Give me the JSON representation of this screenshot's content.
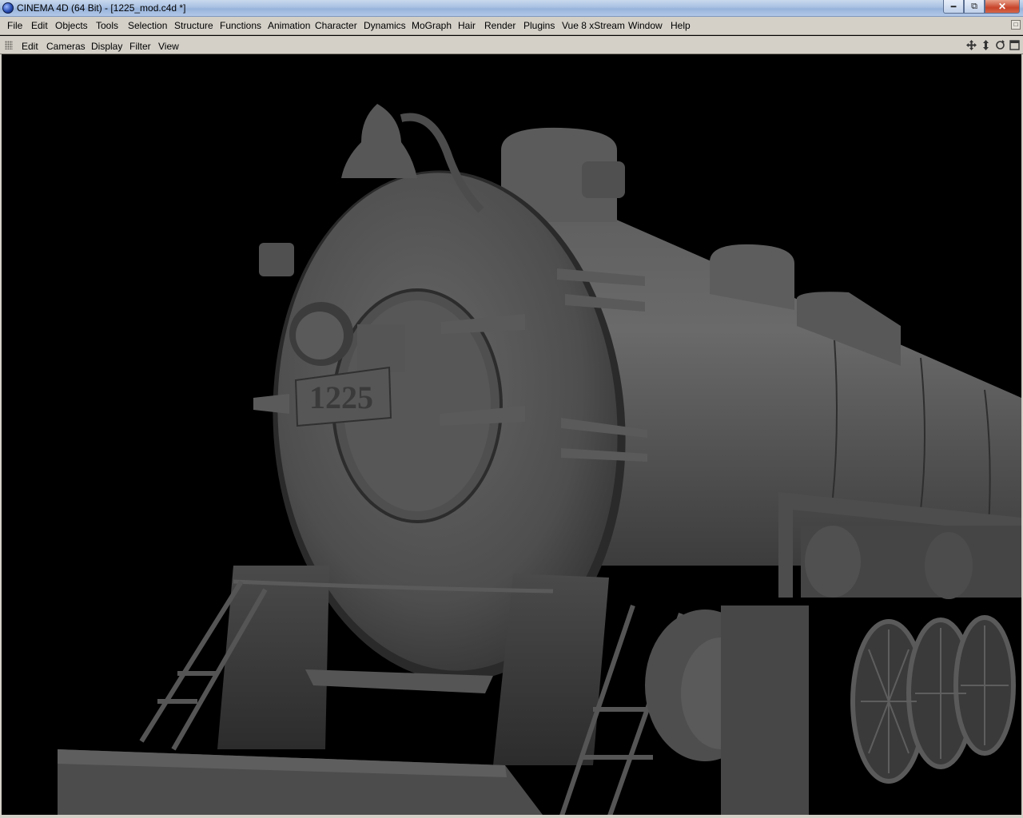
{
  "window": {
    "title": "CINEMA 4D (64 Bit) - [1225_mod.c4d *]",
    "app_icon": "cinema4d-icon",
    "controls": {
      "minimize": "minimize-icon",
      "restore": "restore-icon",
      "close": "close-icon"
    }
  },
  "menubar": {
    "items": [
      "File",
      "Edit",
      "Objects",
      "Tools",
      "Selection",
      "Structure",
      "Functions",
      "Animation",
      "Character",
      "Dynamics",
      "MoGraph",
      "Hair",
      "Render",
      "Plugins",
      "Vue 8 xStream",
      "Window",
      "Help"
    ]
  },
  "viewport_menu": {
    "items": [
      "Edit",
      "Cameras",
      "Display",
      "Filter",
      "View"
    ],
    "nav_icons": [
      "move-view-icon",
      "zoom-view-icon",
      "rotate-view-icon",
      "maximize-view-icon"
    ]
  },
  "viewport": {
    "background": "#000000",
    "scene_label": "1225"
  },
  "colors": {
    "chrome": "#d4d0c8",
    "titlebar": "#a9c1e2",
    "model_gray": "#5a5a5a"
  }
}
